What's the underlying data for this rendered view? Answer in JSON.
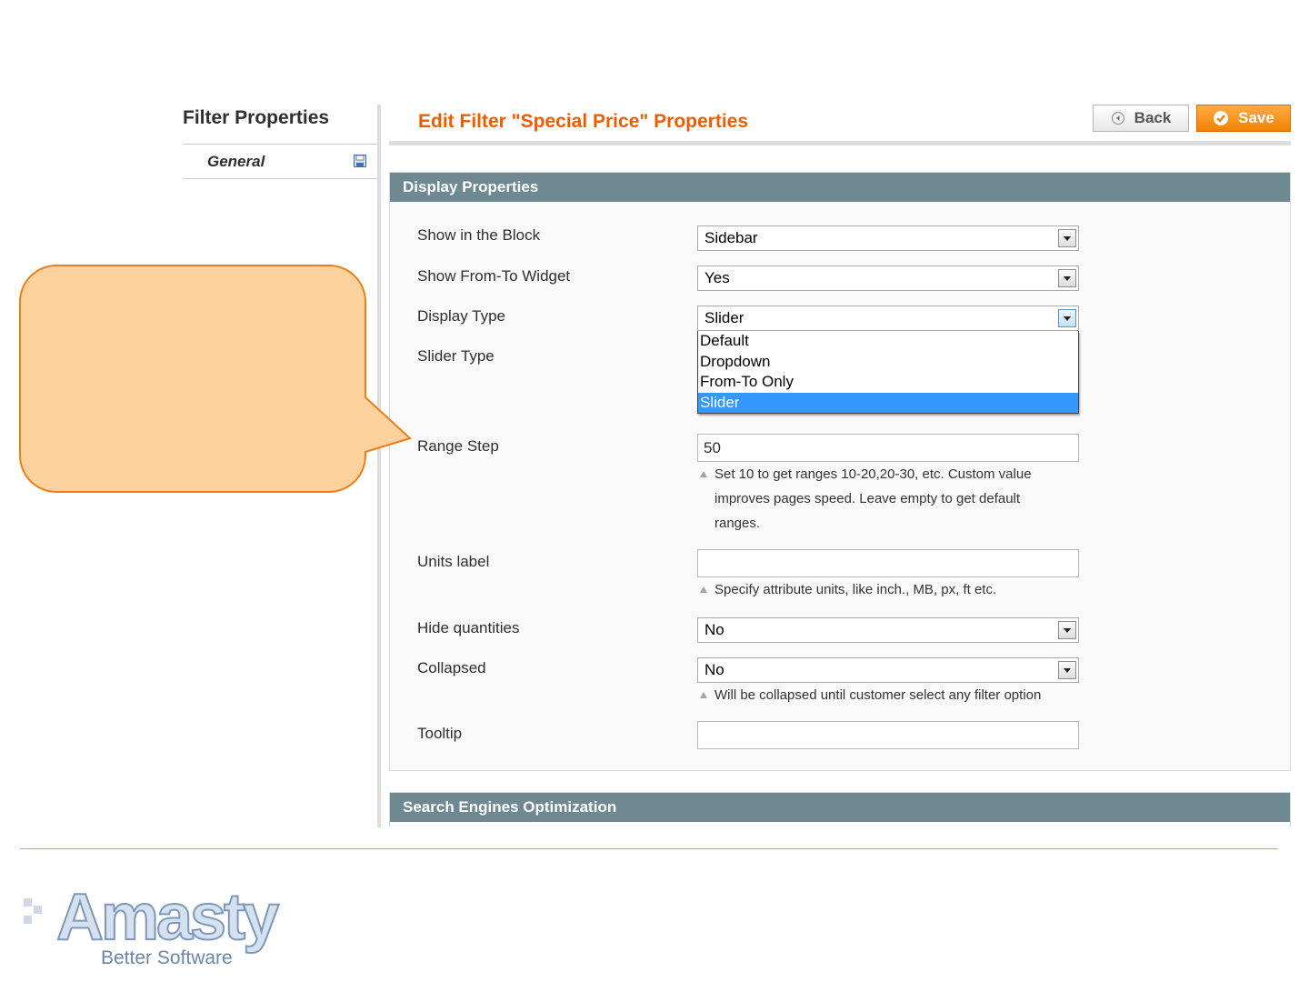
{
  "sidebar": {
    "title": "Filter Properties",
    "tab_label": "General"
  },
  "header": {
    "title": "Edit Filter \"Special Price\" Properties",
    "back_label": "Back",
    "save_label": "Save"
  },
  "display_section": {
    "title": "Display Properties",
    "fields": {
      "show_in_block": {
        "label": "Show in the Block",
        "value": "Sidebar"
      },
      "from_to_widget": {
        "label": "Show From-To Widget",
        "value": "Yes"
      },
      "display_type": {
        "label": "Display Type",
        "value": "Slider",
        "options": [
          "Default",
          "Dropdown",
          "From-To Only",
          "Slider"
        ]
      },
      "slider_type": {
        "label": "Slider Type"
      },
      "range_step": {
        "label": "Range Step",
        "value": "50",
        "note_lines": [
          "Set 10 to get ranges 10-20,20-30, etc. Custom value",
          "improves pages speed. Leave empty to get default",
          "ranges."
        ]
      },
      "units_label": {
        "label": "Units label",
        "value": "",
        "note": "Specify attribute units, like inch., MB, px, ft etc."
      },
      "hide_quantities": {
        "label": "Hide quantities",
        "value": "No"
      },
      "collapsed": {
        "label": "Collapsed",
        "value": "No",
        "note": "Will be collapsed until customer select any filter option"
      },
      "tooltip": {
        "label": "Tooltip",
        "value": ""
      }
    }
  },
  "seo_section": {
    "title": "Search Engines Optimization"
  },
  "brand": {
    "name": "Amasty",
    "tagline": "Better Software"
  },
  "colors": {
    "accent_orange": "#eb5e00",
    "section_head": "#6f8992",
    "callout_fill": "#fed29c",
    "callout_stroke": "#ef7d19",
    "selected_option": "#3399ff"
  },
  "icons": {
    "back": "circle-left-arrow-icon",
    "save": "check-circle-icon",
    "saved_state": "floppy-disk-icon"
  }
}
